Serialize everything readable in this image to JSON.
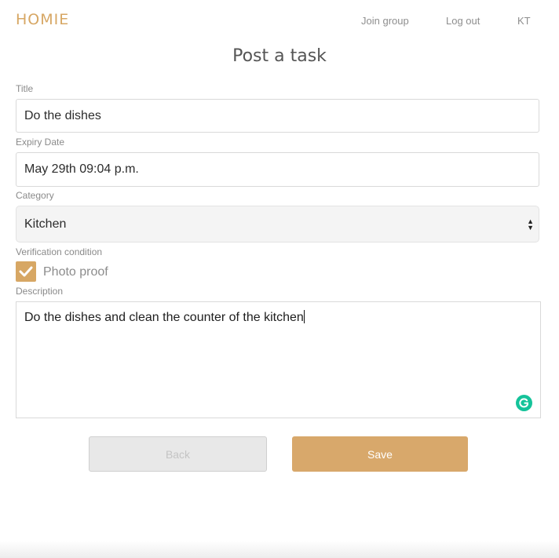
{
  "header": {
    "brand": "HOMIE",
    "nav": {
      "join_group": "Join group",
      "log_out": "Log out",
      "user_initials": "KT"
    }
  },
  "page_title": "Post a task",
  "form": {
    "title": {
      "label": "Title",
      "value": "Do the dishes"
    },
    "expiry": {
      "label": "Expiry Date",
      "value": "May 29th 09:04 p.m."
    },
    "category": {
      "label": "Category",
      "selected": "Kitchen"
    },
    "verification": {
      "label": "Verification condition",
      "option_label": "Photo proof",
      "checked": true
    },
    "description": {
      "label": "Description",
      "value": "Do the dishes and clean the counter of the kitchen"
    }
  },
  "buttons": {
    "back": "Back",
    "save": "Save"
  },
  "icons": {
    "checkbox": "checkmark-icon",
    "grammarly": "grammarly-icon",
    "select": "select-arrows-icon"
  },
  "colors": {
    "accent": "#d7a764",
    "save_button": "#d8a86b",
    "grammarly": "#15c39a"
  }
}
